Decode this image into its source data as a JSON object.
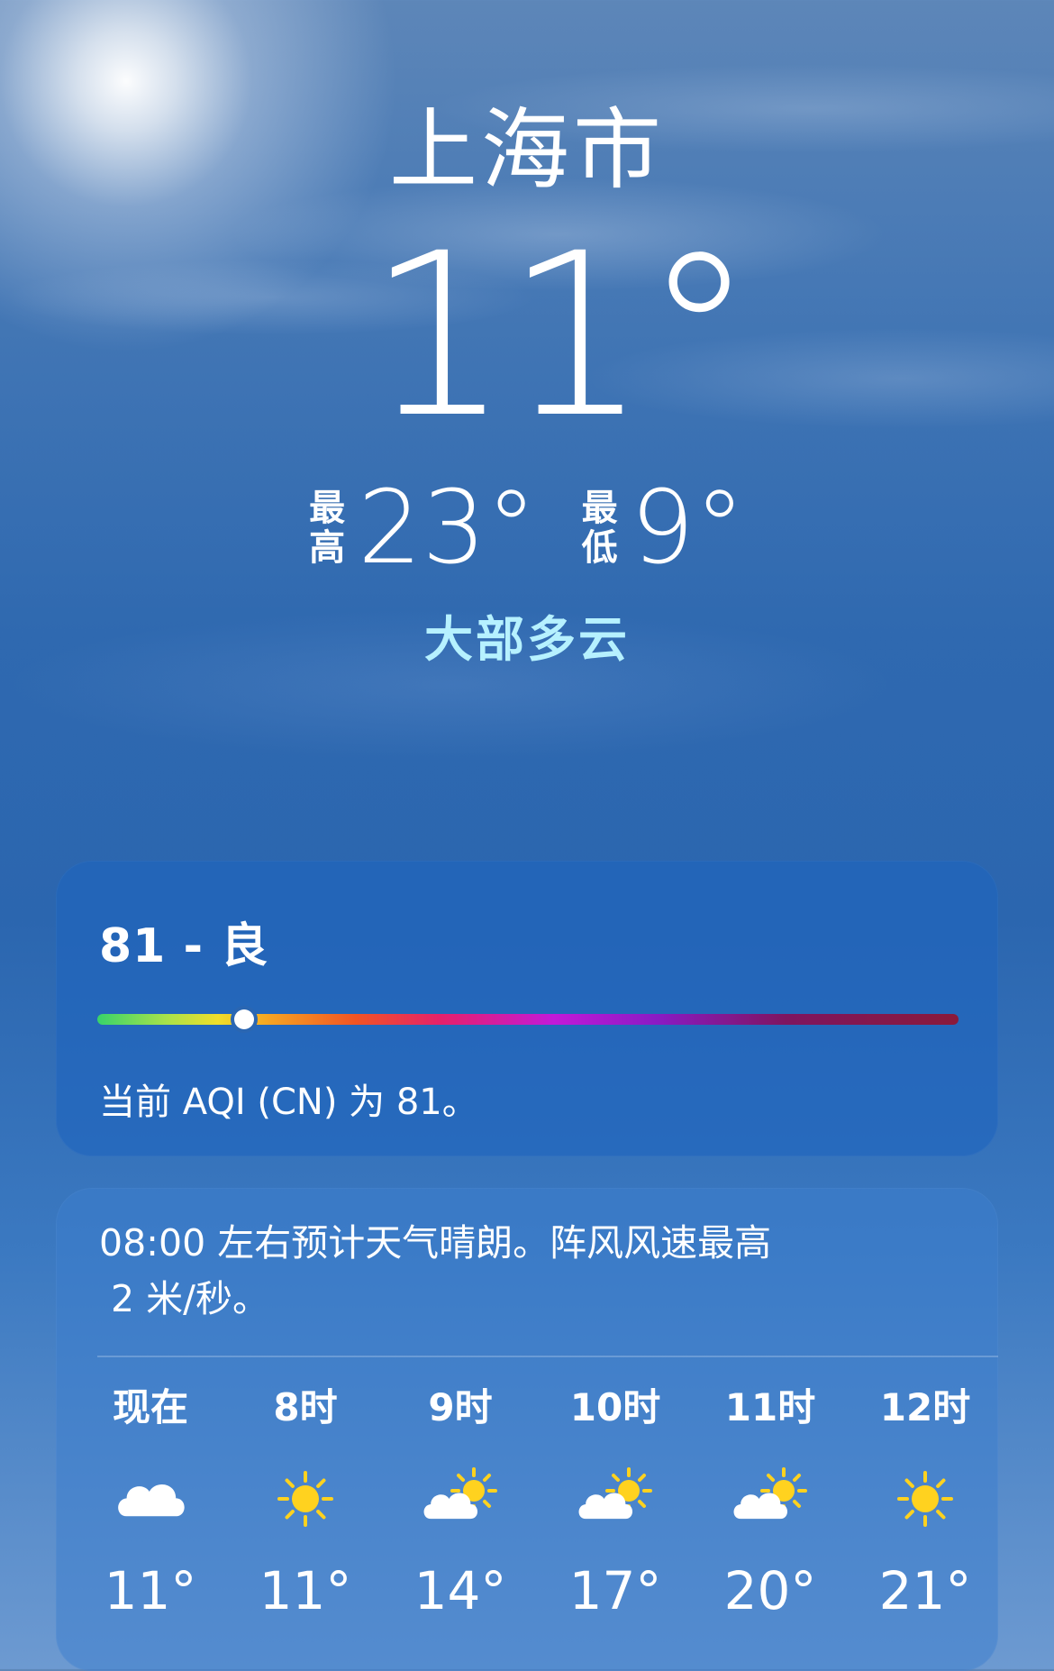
{
  "location": {
    "city": "上海市"
  },
  "current": {
    "temperature": "11°",
    "high_label": [
      "最",
      "高"
    ],
    "high": "23°",
    "low_label": [
      "最",
      "低"
    ],
    "low": "9°",
    "condition": "大部多云"
  },
  "aqi": {
    "title": "81 - 良",
    "description": "当前 AQI (CN) 为 81。",
    "value": 81,
    "marker_fraction": 0.17
  },
  "forecast": {
    "summary_line1": "08:00 左右预计天气晴朗。阵风风速最高",
    "summary_line2": " 2 米/秒。",
    "hours": [
      {
        "label": "现在",
        "icon": "cloud-icon",
        "temp": "11°"
      },
      {
        "label": "8时",
        "icon": "sun-icon",
        "temp": "11°"
      },
      {
        "label": "9时",
        "icon": "partly-cloudy-icon",
        "temp": "14°"
      },
      {
        "label": "10时",
        "icon": "partly-cloudy-icon",
        "temp": "17°"
      },
      {
        "label": "11时",
        "icon": "partly-cloudy-icon",
        "temp": "20°"
      },
      {
        "label": "12时",
        "icon": "sun-icon",
        "temp": "21°"
      }
    ]
  },
  "colors": {
    "condition_text": "#b6f1ff",
    "sun": "#ffd21f",
    "cloud": "#ffffff"
  }
}
